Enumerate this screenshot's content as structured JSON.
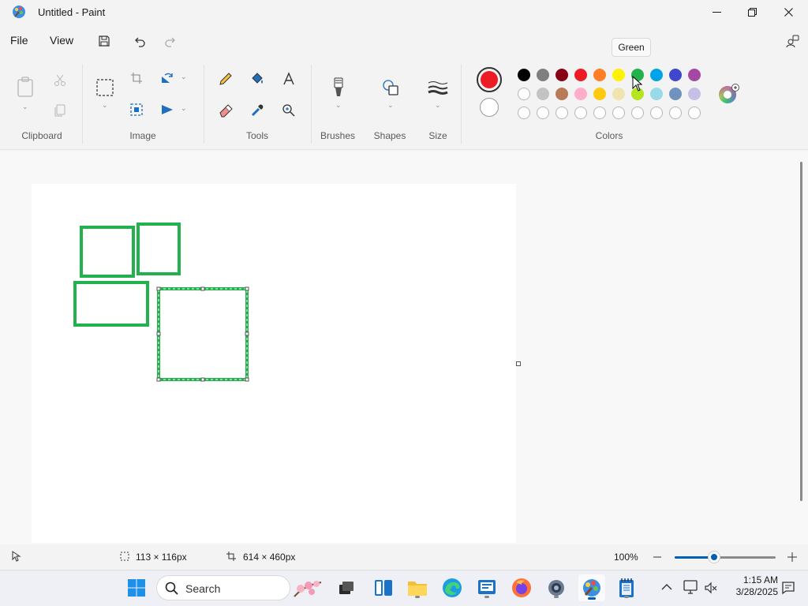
{
  "window": {
    "title": "Untitled - Paint",
    "tooltip": "Green"
  },
  "menu": {
    "file": "File",
    "view": "View"
  },
  "ribbon": {
    "groups": {
      "clipboard": "Clipboard",
      "image": "Image",
      "tools": "Tools",
      "brushes": "Brushes",
      "shapes": "Shapes",
      "size": "Size",
      "colors": "Colors"
    }
  },
  "colors": {
    "primary": "#ed1c24",
    "secondary": "#ffffff",
    "palette_row1": [
      "#000000",
      "#7f7f7f",
      "#880015",
      "#ed1c24",
      "#ff7f27",
      "#fff200",
      "#22b14c",
      "#00a2e8",
      "#3f48cc",
      "#a349a4"
    ],
    "palette_row2": [
      "#ffffff",
      "#c3c3c3",
      "#b97a57",
      "#ffaec9",
      "#ffc90e",
      "#efe4b0",
      "#b5e61d",
      "#99d9ea",
      "#7092be",
      "#c8bfe7"
    ],
    "shape_stroke": "#22b14c"
  },
  "status": {
    "selection_size": "113 × 116px",
    "canvas_size": "614 × 460px",
    "zoom": "100%",
    "zoom_level": 0.39
  },
  "taskbar": {
    "search_label": "Search",
    "time": "1:15 AM",
    "date": "3/28/2025"
  }
}
